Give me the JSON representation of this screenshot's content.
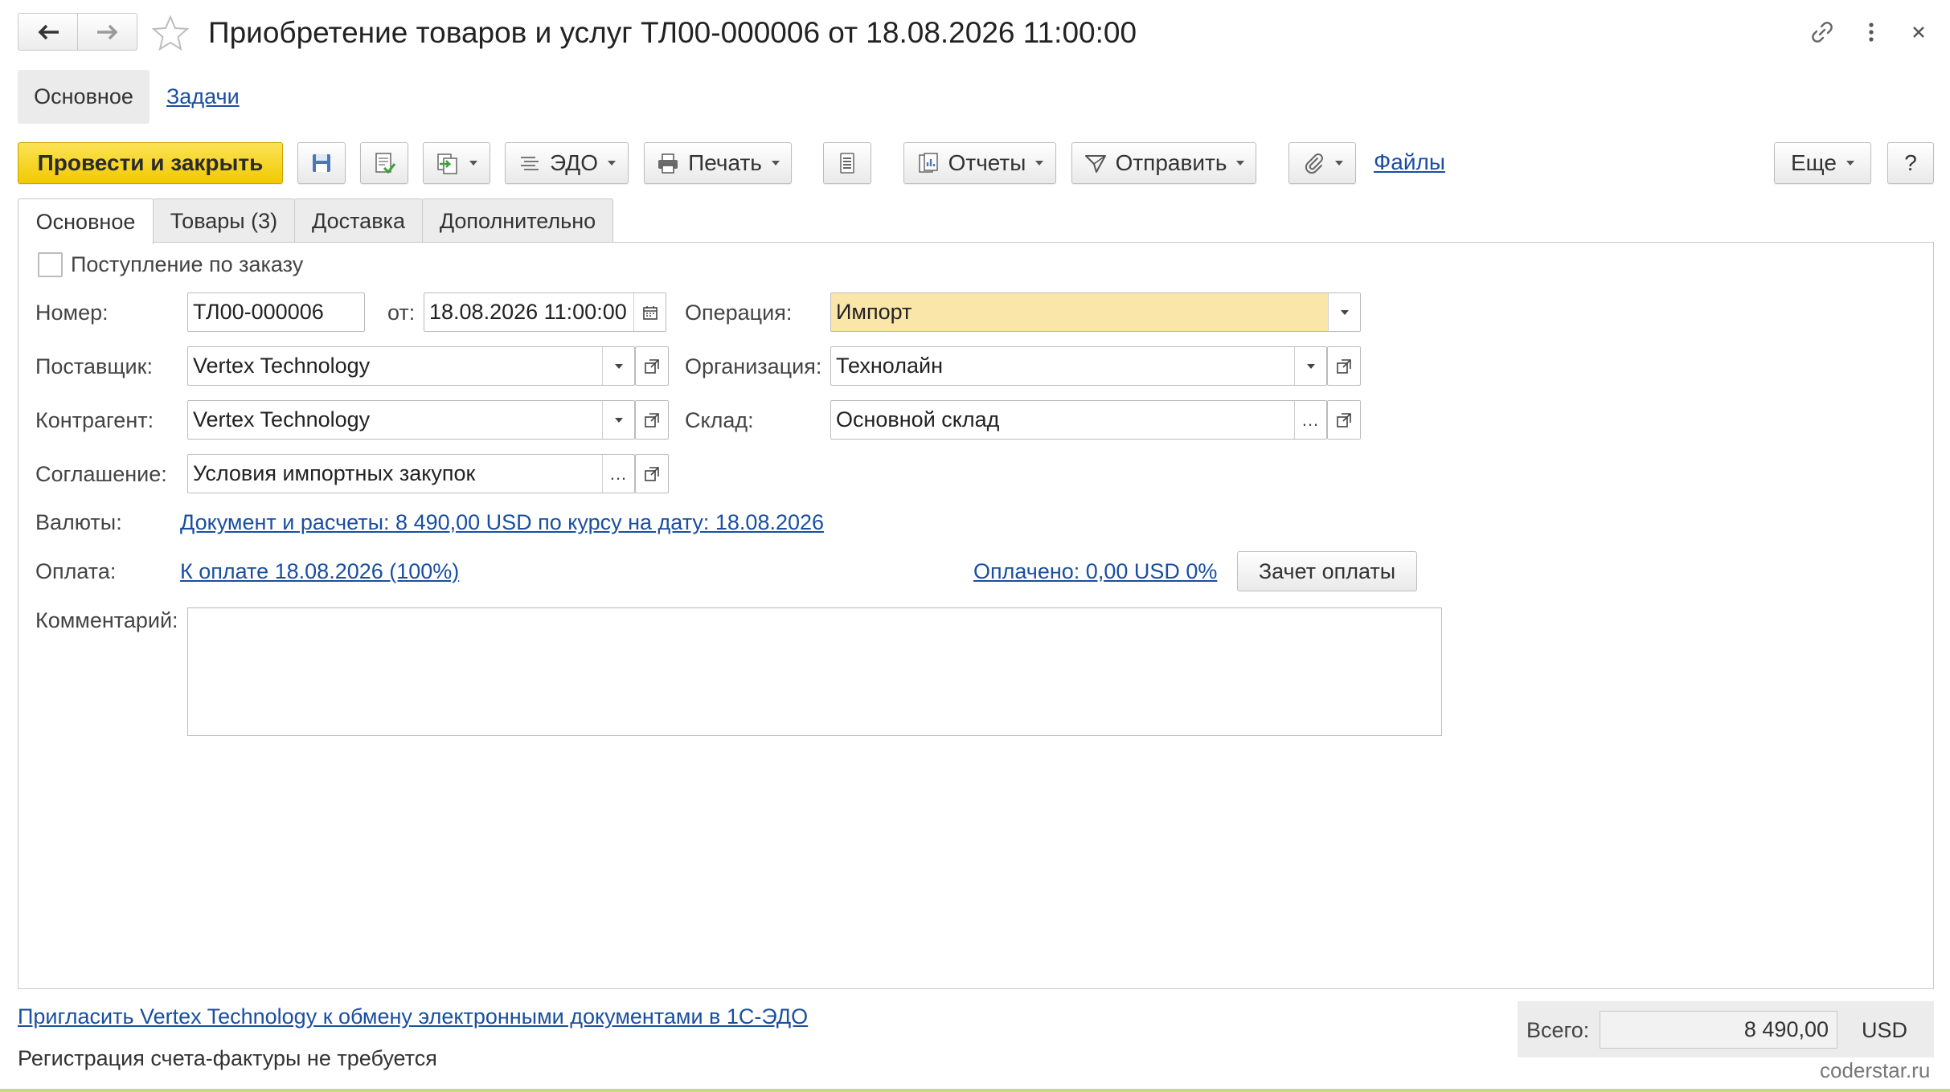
{
  "window": {
    "title": "Приобретение товаров и услуг ТЛ00-000006 от 18.08.2026 11:00:00"
  },
  "nav_tabs": {
    "main": "Основное",
    "tasks": "Задачи"
  },
  "toolbar": {
    "post_close": "Провести и закрыть",
    "edo": "ЭДО",
    "print": "Печать",
    "reports": "Отчеты",
    "send": "Отправить",
    "files": "Файлы",
    "more": "Еще",
    "help": "?"
  },
  "form_tabs": [
    "Основное",
    "Товары (3)",
    "Доставка",
    "Дополнительно"
  ],
  "form": {
    "by_order_label": "Поступление по заказу",
    "by_order_checked": false,
    "number_label": "Номер:",
    "number_value": "ТЛ00-000006",
    "date_label": "от:",
    "date_value": "18.08.2026 11:00:00",
    "operation_label": "Операция:",
    "operation_value": "Импорт",
    "supplier_label": "Поставщик:",
    "supplier_value": "Vertex Technology",
    "organization_label": "Организация:",
    "organization_value": "Технолайн",
    "counterparty_label": "Контрагент:",
    "counterparty_value": "Vertex Technology",
    "warehouse_label": "Склад:",
    "warehouse_value": "Основной склад",
    "agreement_label": "Соглашение:",
    "agreement_value": "Условия импортных закупок",
    "currency_label": "Валюты:",
    "currency_link": "Документ и расчеты: 8 490,00 USD по курсу на дату: 18.08.2026",
    "payment_label": "Оплата:",
    "payment_link": "К оплате 18.08.2026 (100%)",
    "paid_link": "Оплачено: 0,00 USD 0%",
    "offset_button": "Зачет оплаты",
    "comment_label": "Комментарий:",
    "comment_value": ""
  },
  "footer": {
    "invite_link": "Пригласить Vertex Technology к обмену электронными документами в 1С-ЭДО",
    "invoice_note": "Регистрация счета-фактуры не требуется",
    "total_label": "Всего:",
    "total_value": "8 490,00",
    "total_currency": "USD",
    "watermark": "coderstar.ru"
  }
}
